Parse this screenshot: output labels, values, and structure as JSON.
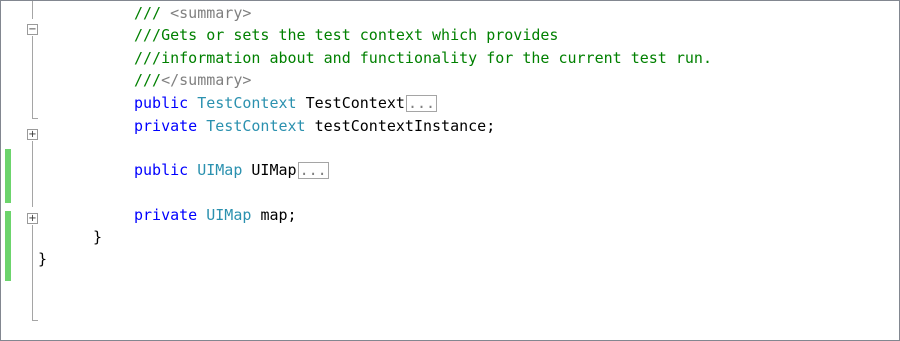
{
  "editor": {
    "lines": {
      "summary_open": {
        "prefix": "///",
        "tag": " <summary>"
      },
      "comment_1": {
        "text": "///Gets or sets the test context which provides"
      },
      "comment_2": {
        "text": "///information about and functionality for the current test run."
      },
      "summary_close": {
        "prefix": "///",
        "tag": "</summary>"
      },
      "prop_testcontext": {
        "modifier": "public",
        "type": "TestContext",
        "name": "TestContext",
        "collapsed": "..."
      },
      "field_testcontext": {
        "modifier": "private",
        "type": "TestContext",
        "name": "testContextInstance;"
      },
      "prop_uimap": {
        "modifier": "public",
        "type": "UIMap",
        "name": "UIMap",
        "collapsed": "..."
      },
      "field_map": {
        "modifier": "private",
        "type": "UIMap",
        "name": "map;"
      },
      "class_close": {
        "text": "}"
      },
      "namespace_close": {
        "text": "}"
      }
    },
    "fold_icons": {
      "expanded": "−",
      "collapsed": "+"
    },
    "colors": {
      "keyword": "#0000ff",
      "type": "#2b91af",
      "comment": "#008000",
      "doc_tag": "#808080",
      "change_bar": "#6cd46c"
    }
  }
}
